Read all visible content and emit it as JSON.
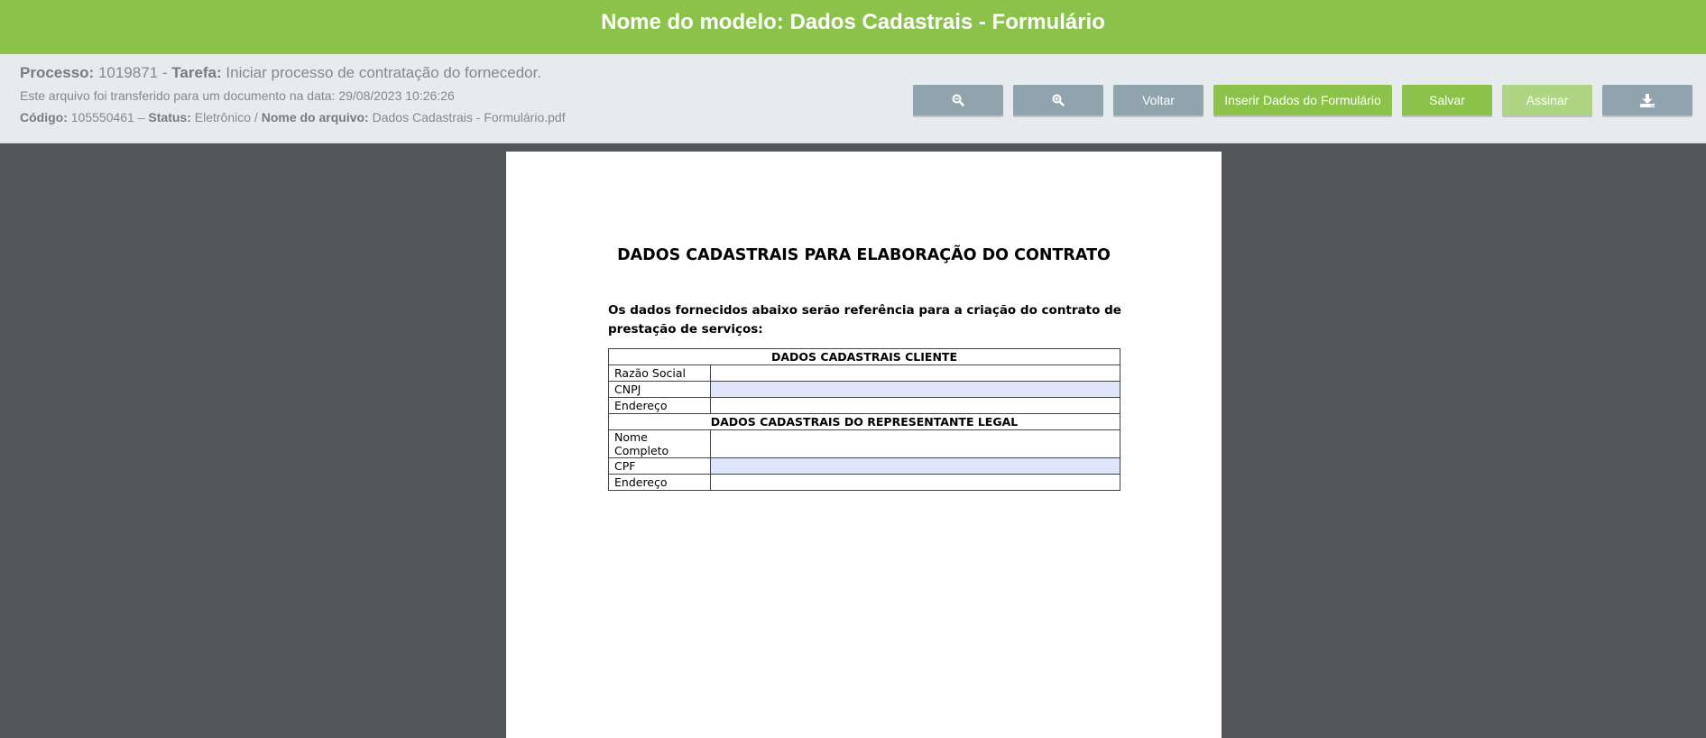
{
  "header": {
    "title": "Nome do modelo: Dados Cadastrais - Formulário"
  },
  "info": {
    "processo_label": "Processo:",
    "processo_value": "1019871 -",
    "tarefa_label": "Tarefa:",
    "tarefa_value": "Iniciar processo de contratação do fornecedor.",
    "transfer_note": "Este arquivo foi transferido para um documento na data: 29/08/2023 10:26:26",
    "codigo_label": "Código:",
    "codigo_value": "105550461 –",
    "status_label": "Status:",
    "status_value": "Eletrônico /",
    "arquivo_label": "Nome do arquivo:",
    "arquivo_value": "Dados Cadastrais - Formulário.pdf"
  },
  "toolbar": {
    "zoom_out_icon": "zoom-out-icon",
    "zoom_in_icon": "zoom-in-icon",
    "voltar_label": "Voltar",
    "inserir_label": "Inserir Dados do Formulário",
    "salvar_label": "Salvar",
    "assinar_label": "Assinar",
    "download_icon": "download-icon"
  },
  "document": {
    "title": "DADOS CADASTRAIS PARA ELABORAÇÃO DO CONTRATO",
    "intro": "Os dados fornecidos abaixo serão referência para a criação do contrato de prestação de serviços:",
    "section_cliente": "DADOS CADASTRAIS CLIENTE",
    "razao_social": "Razão Social",
    "cnpj": "CNPJ",
    "endereco_cliente": "Endereço",
    "section_representante": "DADOS CADASTRAIS DO REPRESENTANTE LEGAL",
    "nome_completo": "Nome Completo",
    "cpf": "CPF",
    "endereco_representante": "Endereço"
  },
  "colors": {
    "brand_green": "#8bc34a",
    "button_grey": "#90a4ae",
    "viewer_bg": "#525659",
    "field_highlight": "#dfe6fb"
  }
}
